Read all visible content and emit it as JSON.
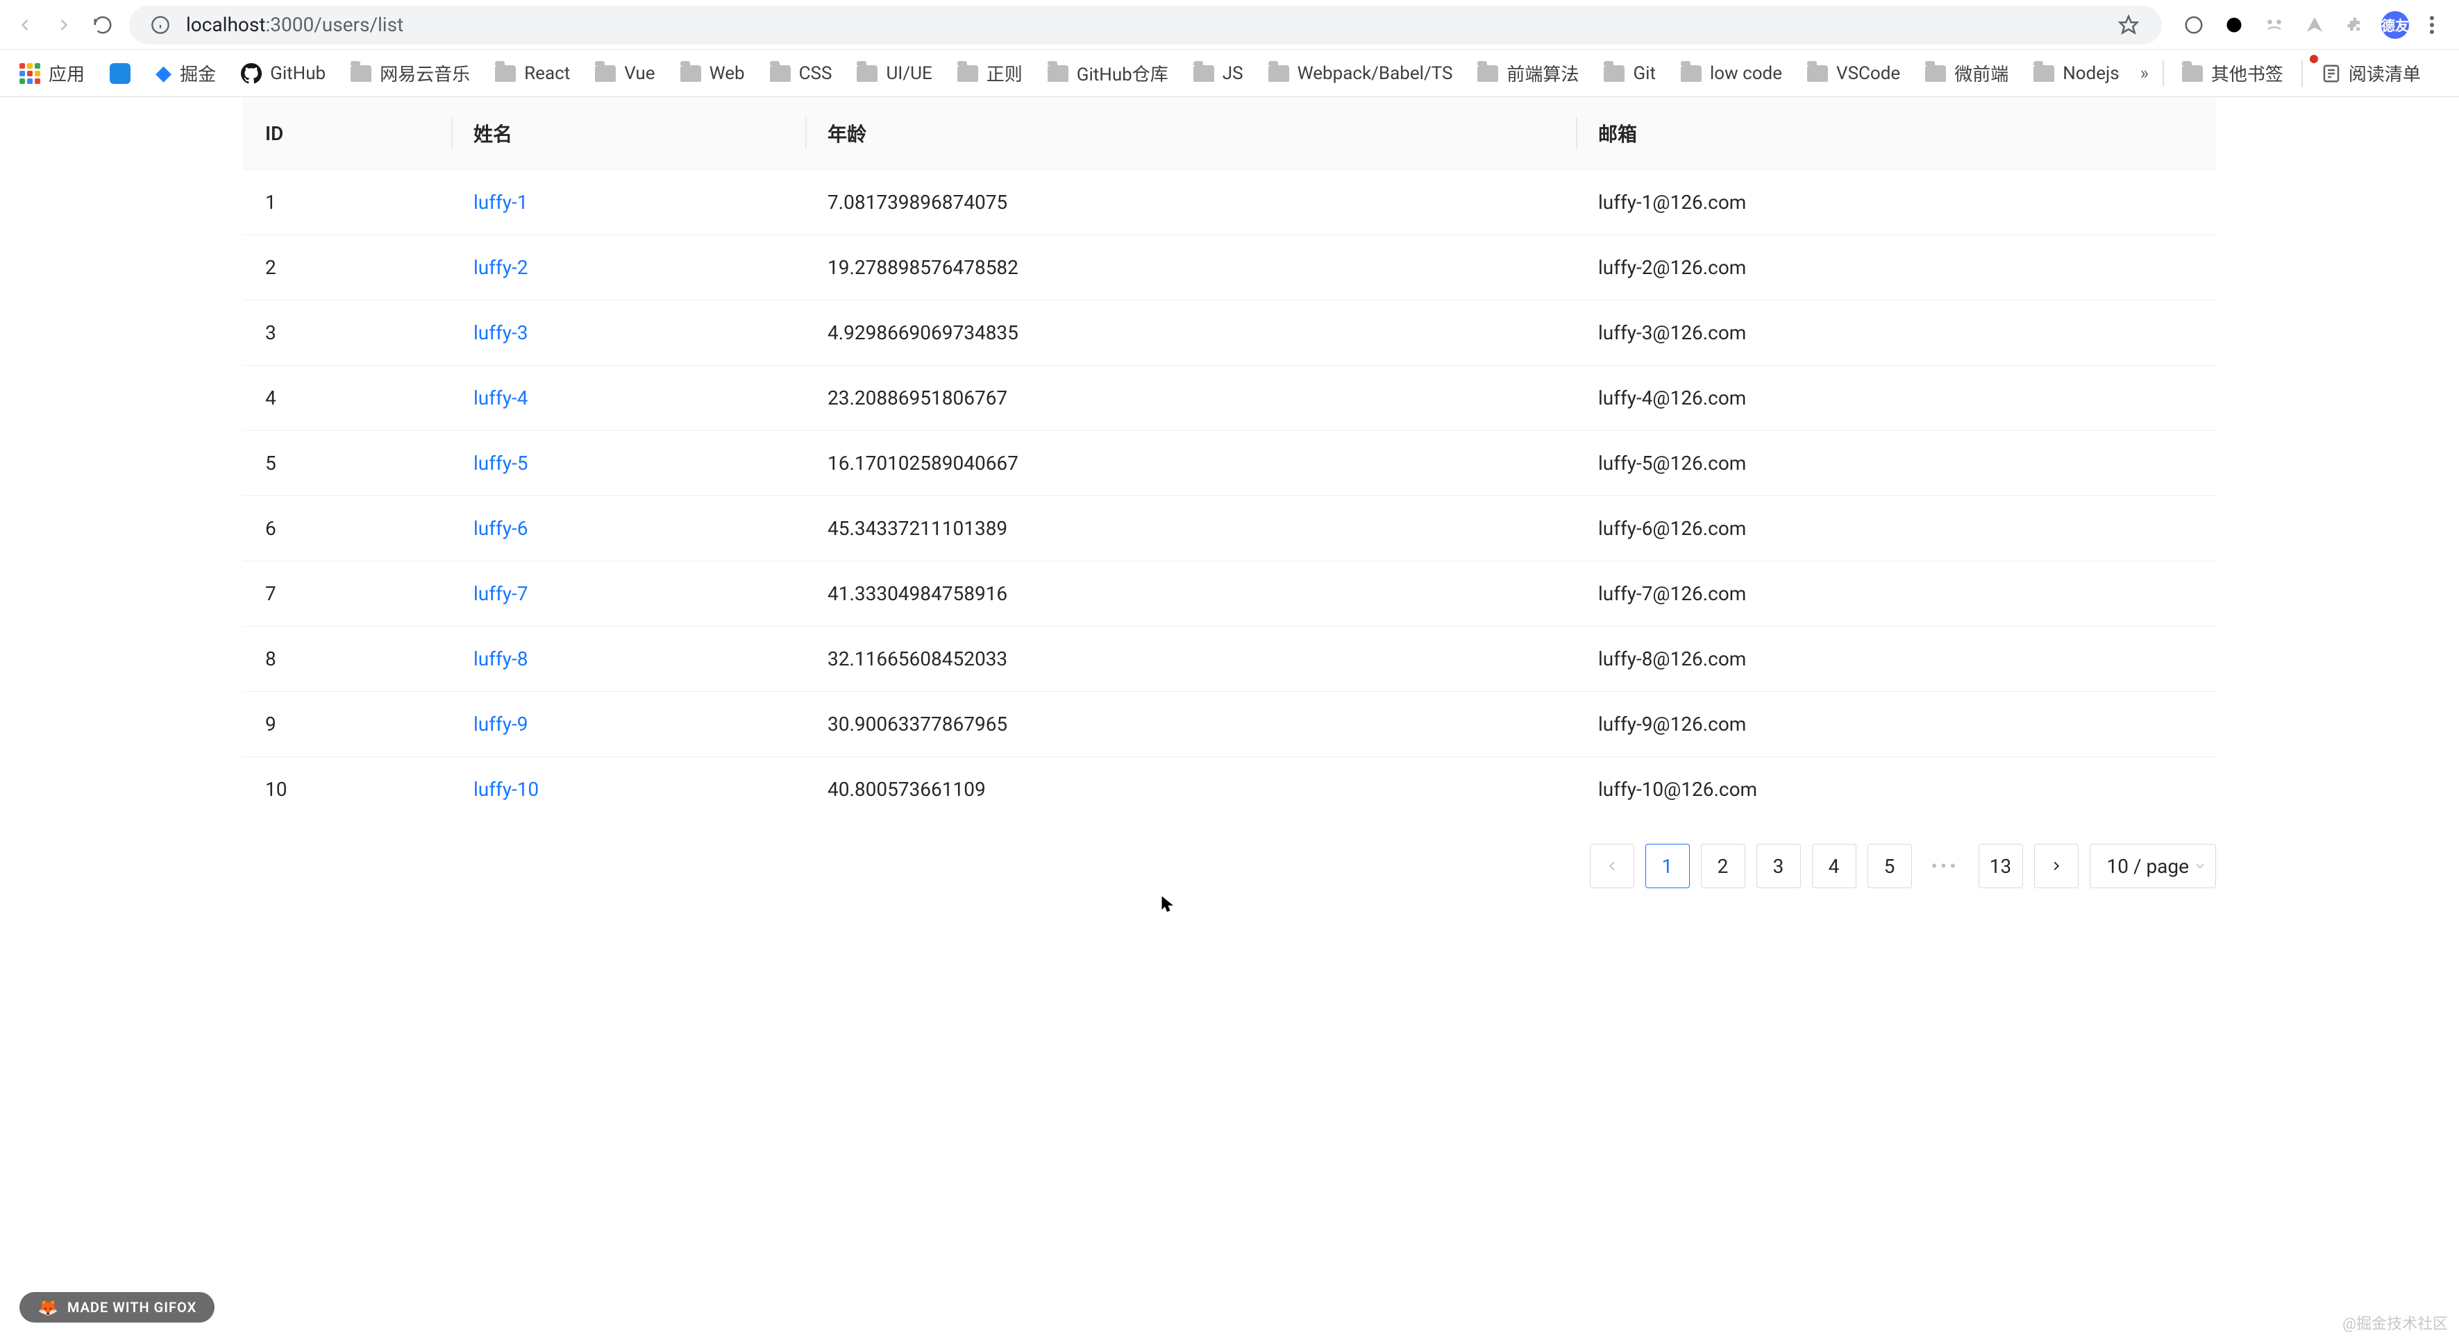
{
  "browser": {
    "url_host": "localhost",
    "url_port_path": ":3000/users/list",
    "avatar_label": "德友"
  },
  "bookmarks": {
    "apps": "应用",
    "items": [
      "掘金",
      "GitHub",
      "网易云音乐",
      "React",
      "Vue",
      "Web",
      "CSS",
      "UI/UE",
      "正则",
      "GitHub仓库",
      "JS",
      "Webpack/Babel/TS",
      "前端算法",
      "Git",
      "low code",
      "VSCode",
      "微前端",
      "Nodejs"
    ],
    "overflow": "»",
    "other": "其他书签",
    "reading": "阅读清单"
  },
  "table": {
    "columns": {
      "id": "ID",
      "name": "姓名",
      "age": "年龄",
      "email": "邮箱"
    },
    "rows": [
      {
        "id": "1",
        "name": "luffy-1",
        "age": "7.081739896874075",
        "email": "luffy-1@126.com"
      },
      {
        "id": "2",
        "name": "luffy-2",
        "age": "19.278898576478582",
        "email": "luffy-2@126.com"
      },
      {
        "id": "3",
        "name": "luffy-3",
        "age": "4.9298669069734835",
        "email": "luffy-3@126.com"
      },
      {
        "id": "4",
        "name": "luffy-4",
        "age": "23.20886951806767",
        "email": "luffy-4@126.com"
      },
      {
        "id": "5",
        "name": "luffy-5",
        "age": "16.170102589040667",
        "email": "luffy-5@126.com"
      },
      {
        "id": "6",
        "name": "luffy-6",
        "age": "45.34337211101389",
        "email": "luffy-6@126.com"
      },
      {
        "id": "7",
        "name": "luffy-7",
        "age": "41.33304984758916",
        "email": "luffy-7@126.com"
      },
      {
        "id": "8",
        "name": "luffy-8",
        "age": "32.11665608452033",
        "email": "luffy-8@126.com"
      },
      {
        "id": "9",
        "name": "luffy-9",
        "age": "30.90063377867965",
        "email": "luffy-9@126.com"
      },
      {
        "id": "10",
        "name": "luffy-10",
        "age": "40.800573661109",
        "email": "luffy-10@126.com"
      }
    ]
  },
  "pagination": {
    "pages": [
      "1",
      "2",
      "3",
      "4",
      "5"
    ],
    "last": "13",
    "active": "1",
    "size_label": "10 / page"
  },
  "badge": {
    "text": "MADE WITH GIFOX"
  },
  "watermark": {
    "text": "@掘金技术社区"
  }
}
